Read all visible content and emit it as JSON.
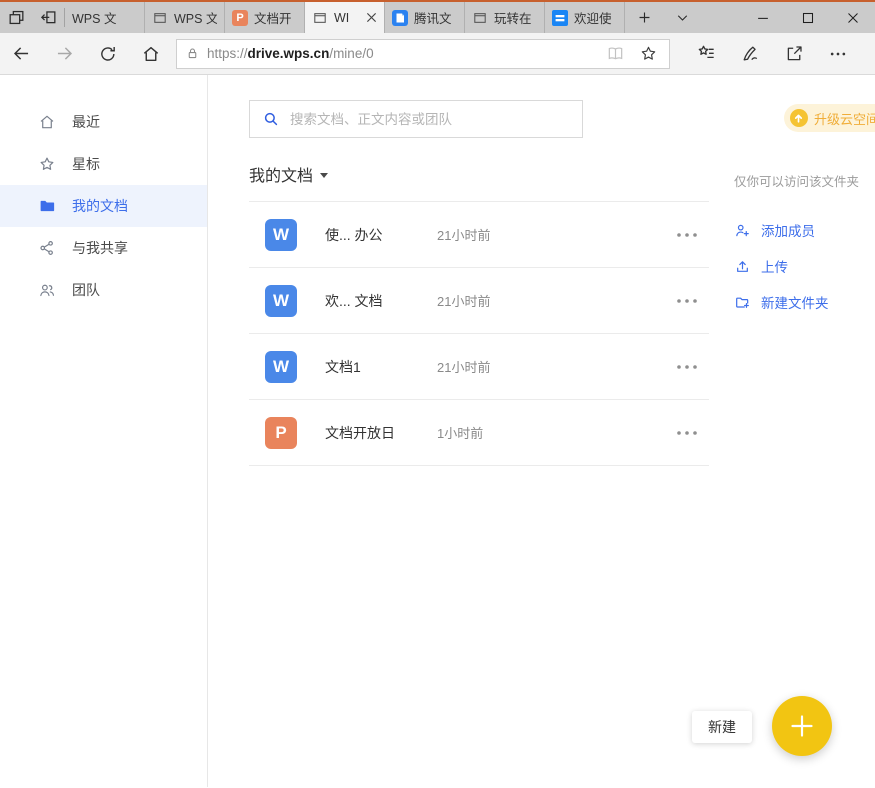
{
  "browser": {
    "tab_strip_buttons": {
      "tab_preview": "tab-preview-icon",
      "set_tabs_aside": "set-tabs-aside-icon",
      "new_tab": "plus-icon",
      "tabs_dropdown": "chevron-down-icon"
    },
    "tabs": [
      {
        "label": "WPS 文",
        "icon": "none",
        "active": false
      },
      {
        "label": "WPS 文",
        "icon": "window",
        "active": false
      },
      {
        "label": "文档开",
        "icon": "wps-presentation",
        "letter": "P",
        "active": false
      },
      {
        "label": "WI",
        "icon": "window",
        "active": true
      },
      {
        "label": "腾讯文",
        "icon": "tencent-docs",
        "active": false
      },
      {
        "label": "玩转在",
        "icon": "window",
        "active": false
      },
      {
        "label": "欢迎使",
        "icon": "welcome",
        "active": false
      }
    ],
    "window_controls": [
      "minimize",
      "maximize",
      "close"
    ],
    "address": {
      "scheme": "https://",
      "host": "drive.wps.cn",
      "path": "/mine/0"
    }
  },
  "sidebar": {
    "items": [
      {
        "label": "最近",
        "icon": "home-icon",
        "selected": false
      },
      {
        "label": "星标",
        "icon": "star-icon",
        "selected": false
      },
      {
        "label": "我的文档",
        "icon": "folder-icon",
        "selected": true
      },
      {
        "label": "与我共享",
        "icon": "share-icon",
        "selected": false
      },
      {
        "label": "团队",
        "icon": "team-icon",
        "selected": false
      }
    ]
  },
  "main": {
    "search": {
      "placeholder": "搜索文档、正文内容或团队"
    },
    "title": "我的文档",
    "files": [
      {
        "name": "使... 办公",
        "time": "21小时前",
        "type": "wps-writer",
        "letter": "W"
      },
      {
        "name": "欢... 文档",
        "time": "21小时前",
        "type": "wps-writer",
        "letter": "W"
      },
      {
        "name": "文档1",
        "time": "21小时前",
        "type": "wps-writer",
        "letter": "W"
      },
      {
        "name": "文档开放日",
        "time": "1小时前",
        "type": "wps-presentation",
        "letter": "P"
      }
    ]
  },
  "right_panel": {
    "upgrade_label": "升级云空间",
    "access_note": "仅你可以访问该文件夹",
    "actions": [
      {
        "label": "添加成员",
        "icon": "add-member-icon"
      },
      {
        "label": "上传",
        "icon": "upload-icon"
      },
      {
        "label": "新建文件夹",
        "icon": "new-folder-icon"
      }
    ]
  },
  "fab": {
    "label": "新建"
  },
  "colors": {
    "accent-blue": "#3d6eea",
    "writer-blue": "#4a88e8",
    "ppt-orange": "#e9845c",
    "fab-yellow": "#f2c512",
    "badge-bg": "#fdf3d9",
    "badge-text": "#f0ad38",
    "badge-circle": "#f5c332",
    "selected-bg": "#eef3fd",
    "top-strip": "#c7602e"
  }
}
